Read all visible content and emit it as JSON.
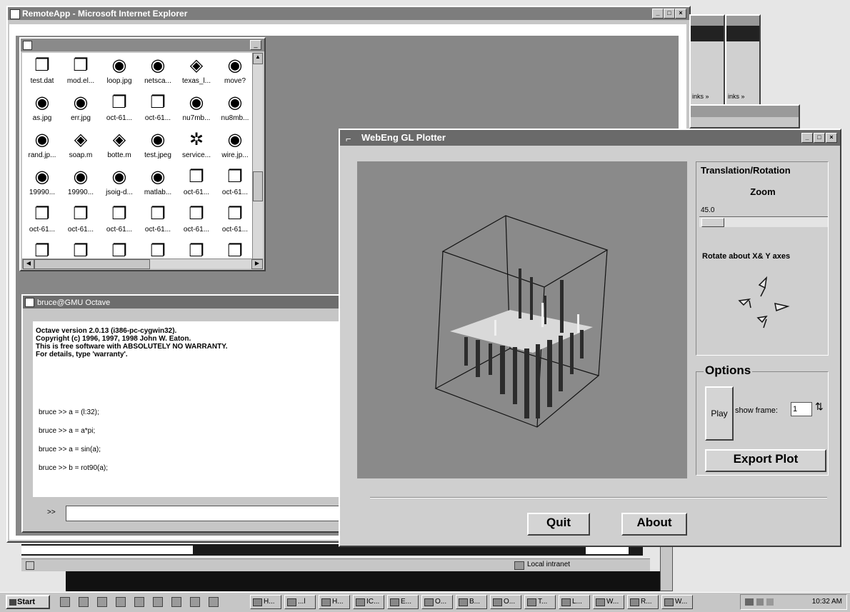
{
  "ie_window": {
    "title": "RemoteApp - Microsoft Internet Explorer",
    "status_zone": "Local intranet"
  },
  "file_browser": {
    "title": "",
    "icons": [
      {
        "label": "test.dat",
        "icon": "document-icon"
      },
      {
        "label": "mod.el...",
        "icon": "document-icon"
      },
      {
        "label": "loop.jpg",
        "icon": "image-icon"
      },
      {
        "label": "netsca...",
        "icon": "image-icon"
      },
      {
        "label": "texas_l...",
        "icon": "disk-icon"
      },
      {
        "label": "move?",
        "icon": "image-icon"
      },
      {
        "label": "as.jpg",
        "icon": "image-icon"
      },
      {
        "label": "err.jpg",
        "icon": "image-icon"
      },
      {
        "label": "oct-61...",
        "icon": "document-icon"
      },
      {
        "label": "oct-61...",
        "icon": "document-icon"
      },
      {
        "label": "nu7mb...",
        "icon": "image-icon"
      },
      {
        "label": "nu8mb...",
        "icon": "image-icon"
      },
      {
        "label": "rand.jp...",
        "icon": "image-icon"
      },
      {
        "label": "soap.m",
        "icon": "disk-icon"
      },
      {
        "label": "botte.m",
        "icon": "disk-icon"
      },
      {
        "label": "test.jpeg",
        "icon": "image-icon"
      },
      {
        "label": "service...",
        "icon": "gears-icon"
      },
      {
        "label": "wire.jp...",
        "icon": "image-icon"
      },
      {
        "label": "19990...",
        "icon": "image-icon"
      },
      {
        "label": "19990...",
        "icon": "image-icon"
      },
      {
        "label": "jsoig-d...",
        "icon": "image-icon"
      },
      {
        "label": "matlab...",
        "icon": "image-icon"
      },
      {
        "label": "oct-61...",
        "icon": "document-icon"
      },
      {
        "label": "oct-61...",
        "icon": "document-icon"
      },
      {
        "label": "oct-61...",
        "icon": "document-icon"
      },
      {
        "label": "oct-61...",
        "icon": "document-icon"
      },
      {
        "label": "oct-61...",
        "icon": "document-icon"
      },
      {
        "label": "oct-61...",
        "icon": "document-icon"
      },
      {
        "label": "oct-61...",
        "icon": "document-icon"
      },
      {
        "label": "oct-61...",
        "icon": "document-icon"
      },
      {
        "label": "",
        "icon": "document-icon"
      },
      {
        "label": "",
        "icon": "document-icon"
      },
      {
        "label": "",
        "icon": "document-icon"
      },
      {
        "label": "",
        "icon": "document-icon"
      },
      {
        "label": "",
        "icon": "document-icon"
      },
      {
        "label": "",
        "icon": "document-icon"
      }
    ]
  },
  "octave": {
    "title": "bruce@GMU Octave",
    "banner": [
      "Octave version 2.0.13 (i386-pc-cygwin32).",
      "Copyright (c) 1996, 1997, 1998 John W. Eaton.",
      "This is free software with ABSOLUTELY NO WARRANTY.",
      "For details, type 'warranty'."
    ],
    "commands": [
      "bruce >> a = (l:32);",
      "bruce >> a = a*pi;",
      "bruce >> a = sin(a);",
      "bruce >> b = rot90(a);"
    ],
    "prompt": ">>",
    "input_value": ""
  },
  "mini_windows": [
    {
      "label": "inks »"
    },
    {
      "label": "inks »"
    }
  ],
  "plotter": {
    "title": "WebEng GL Plotter",
    "translation_rotation_label": "Translation/Rotation",
    "zoom_label": "Zoom",
    "zoom_value": "45.0",
    "zoom_level": 0.2,
    "rotate_label": "Rotate about X& Y axes",
    "options_label": "Options",
    "play_label": "Play",
    "show_frame_label": "show frame:",
    "frame_value": "1",
    "export_label": "Export Plot",
    "quit_label": "Quit",
    "about_label": "About"
  },
  "taskbar": {
    "start_label": "Start",
    "quicklaunch_icons": [
      "desktop-icon",
      "explorer-icon",
      "network-icon",
      "link-icon",
      "browser-icon",
      "monitor-icon",
      "terminal-icon",
      "tool-icon",
      "pin-icon"
    ],
    "tasks": [
      "H...",
      "...l",
      "H...",
      "IC...",
      "E...",
      "O...",
      "B...",
      "O...",
      "T...",
      "L...",
      "W...",
      "R...",
      "W..."
    ],
    "clock": "10:32 AM"
  },
  "colors": {
    "desktop": "#e6e6e6",
    "window_face": "#c6c6c6",
    "titlebar": "#7d7d7d",
    "plot_bg": "#8a8a8a"
  }
}
